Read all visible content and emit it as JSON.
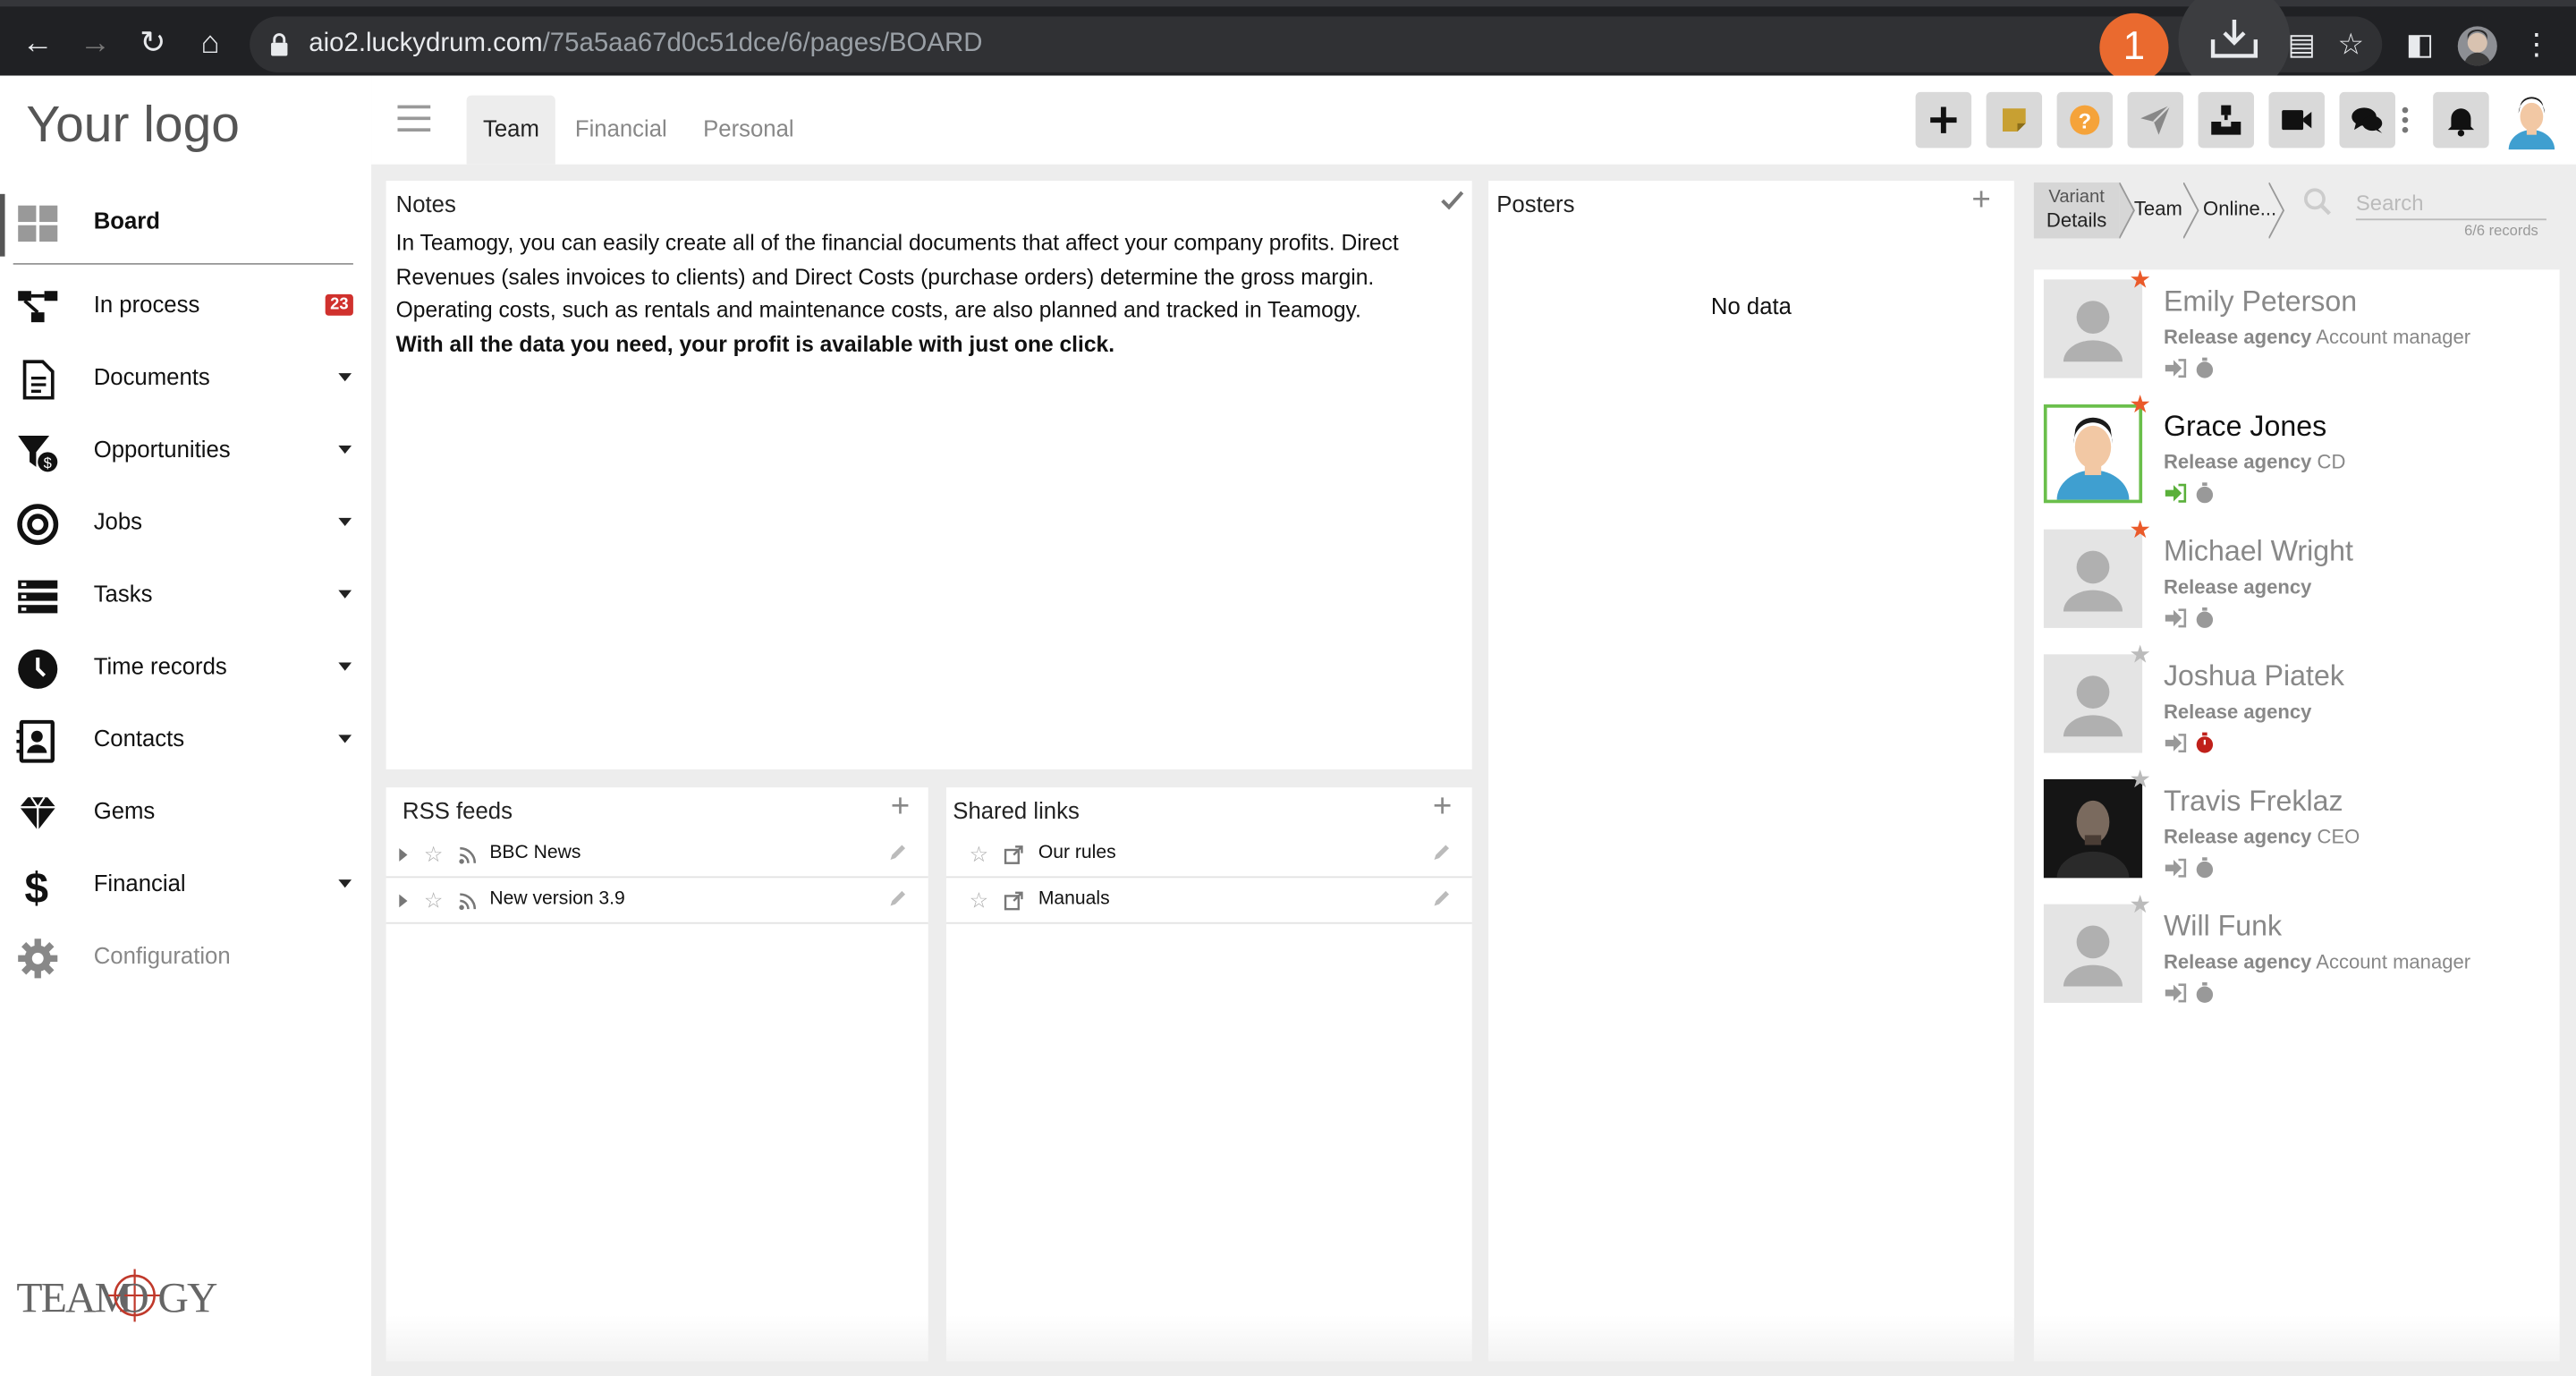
{
  "browser": {
    "url_host": "aio2.luckydrum.com",
    "url_path": "/75a5aa67d0c51dce/6/pages/BOARD",
    "download_count": "1"
  },
  "sidebar": {
    "logo": "Your logo",
    "items": [
      {
        "label": "Board",
        "icon": "grid-icon"
      },
      {
        "label": "In process",
        "icon": "process-icon",
        "badge": "23"
      },
      {
        "label": "Documents",
        "icon": "document-icon"
      },
      {
        "label": "Opportunities",
        "icon": "funnel-dollar-icon"
      },
      {
        "label": "Jobs",
        "icon": "target-icon"
      },
      {
        "label": "Tasks",
        "icon": "tasks-icon"
      },
      {
        "label": "Time records",
        "icon": "clock-icon"
      },
      {
        "label": "Contacts",
        "icon": "contact-book-icon"
      },
      {
        "label": "Gems",
        "icon": "gem-icon"
      },
      {
        "label": "Financial",
        "icon": "dollar-icon"
      },
      {
        "label": "Configuration",
        "icon": "gear-icon"
      }
    ],
    "brand": "TEAMOGY"
  },
  "topbar": {
    "tabs": [
      "Team",
      "Financial",
      "Personal"
    ],
    "active_tab": "Team",
    "buttons": [
      "add-icon",
      "sticky-note-icon",
      "help-icon",
      "send-icon",
      "inbox-icon",
      "video-icon",
      "chat-icon",
      "more-icon",
      "bell-icon"
    ],
    "colors": {
      "help": "#f5a33a",
      "note": "#c8a032"
    }
  },
  "notes": {
    "title": "Notes",
    "text": "In Teamogy, you can easily create all of the financial documents that affect your company profits. Direct Revenues (sales invoices to clients) and Direct Costs (purchase orders) determine the gross margin. Operating costs, such as rentals and maintenance costs, are also planned and tracked in Teamogy.",
    "bold_text": "With all the data you need, your profit is available with just one click."
  },
  "rss": {
    "title": "RSS feeds",
    "items": [
      "BBC News",
      "New version 3.9"
    ]
  },
  "shared_links": {
    "title": "Shared links",
    "items": [
      "Our rules",
      "Manuals"
    ]
  },
  "posters": {
    "title": "Posters",
    "empty": "No data"
  },
  "team": {
    "crumbs": {
      "variant_top": "Variant",
      "variant_bottom": "Details",
      "team": "Team",
      "online": "Online..."
    },
    "search_placeholder": "Search",
    "records": "6/6 records",
    "people": [
      {
        "name": "Emily Peterson",
        "org": "Release agency",
        "role": "Account manager",
        "starred": true,
        "online": false,
        "timer_active": false
      },
      {
        "name": "Grace Jones",
        "org": "Release agency",
        "role": "CD",
        "starred": true,
        "online": true,
        "timer_active": false,
        "selected": true
      },
      {
        "name": "Michael Wright",
        "org": "Release agency",
        "role": "",
        "starred": true,
        "online": false,
        "timer_active": false
      },
      {
        "name": "Joshua Piatek",
        "org": "Release agency",
        "role": "",
        "starred": false,
        "online": false,
        "timer_active": true
      },
      {
        "name": "Travis Freklaz",
        "org": "Release agency",
        "role": "CEO",
        "starred": false,
        "online": false,
        "timer_active": false
      },
      {
        "name": "Will Funk",
        "org": "Release agency",
        "role": "Account manager",
        "starred": false,
        "online": false,
        "timer_active": false
      }
    ],
    "colors": {
      "star_on": "#ea5a2a",
      "star_off": "#bbbbbb",
      "online": "#5ab03a",
      "timer_active": "#c0201a"
    }
  }
}
